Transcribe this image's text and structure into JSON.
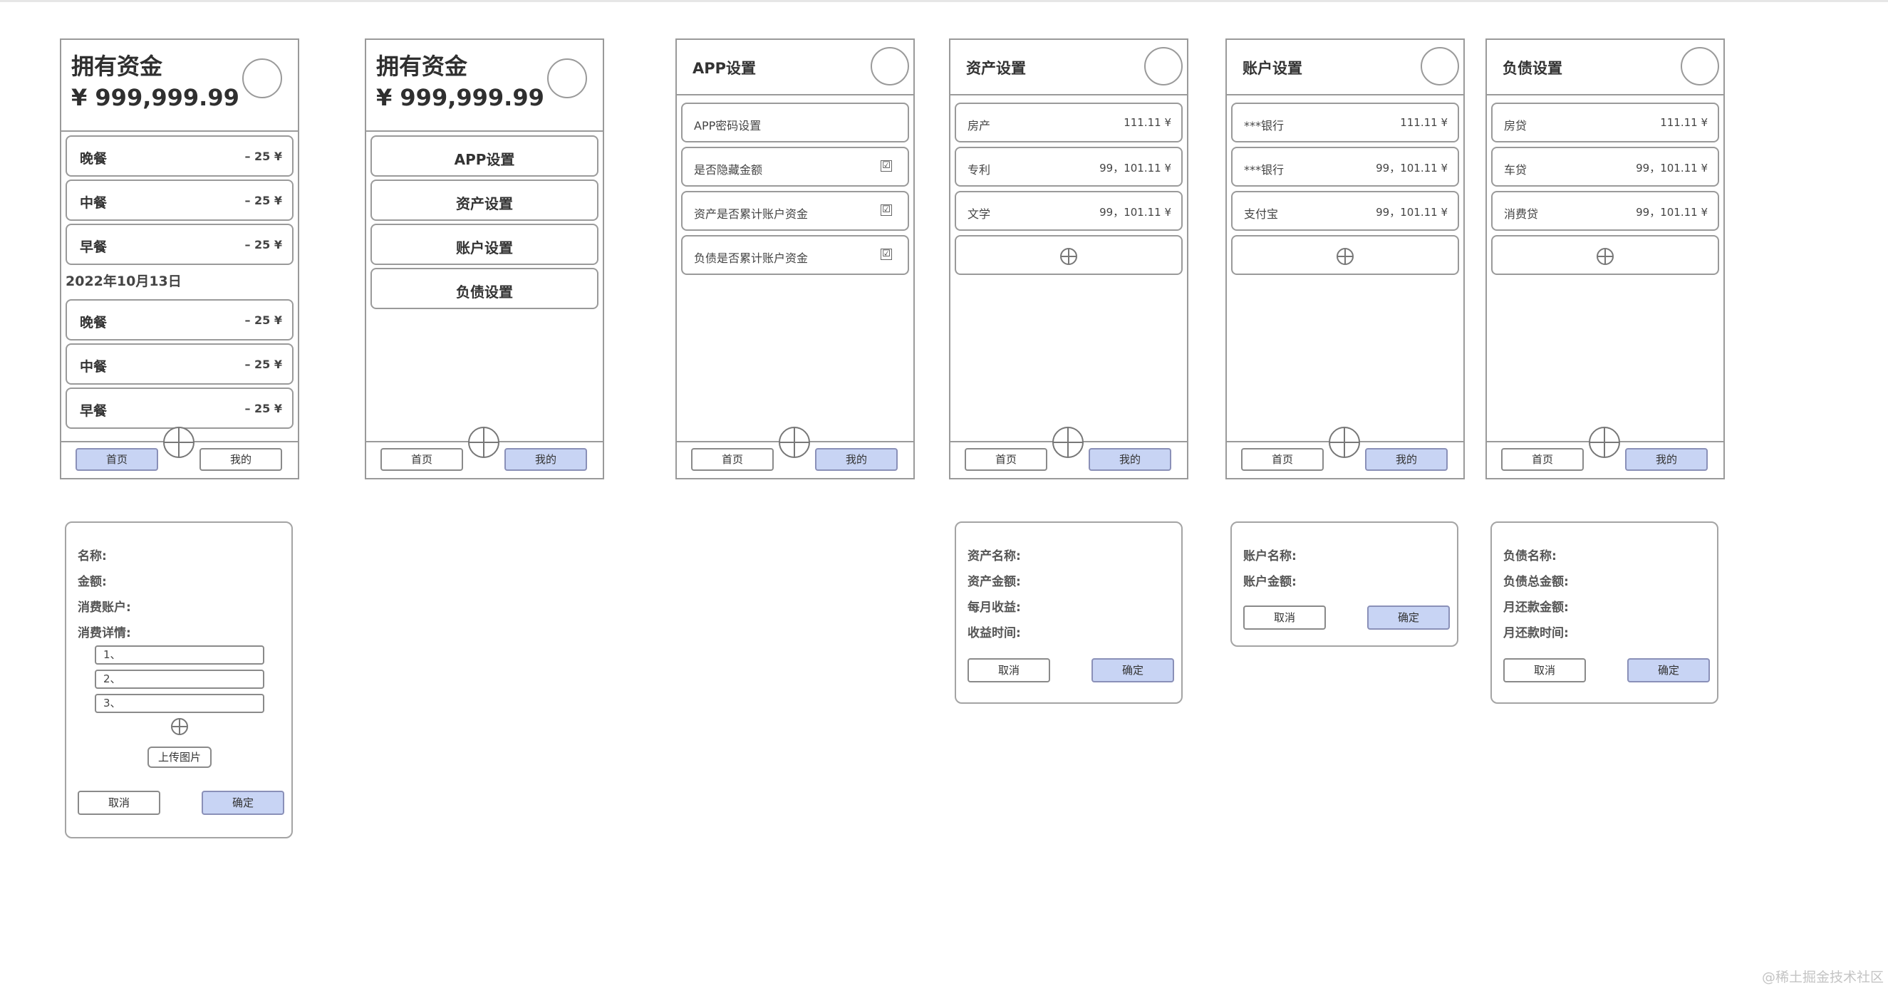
{
  "home": {
    "title": "拥有资金",
    "amount": "¥ 999,999.99",
    "items_today": [
      {
        "label": "晚餐",
        "value": "– 25 ¥"
      },
      {
        "label": "中餐",
        "value": "– 25 ¥"
      },
      {
        "label": "早餐",
        "value": "– 25 ¥"
      }
    ],
    "date_label": "2022年10月13日",
    "items_prev": [
      {
        "label": "晚餐",
        "value": "– 25 ¥"
      },
      {
        "label": "中餐",
        "value": "– 25 ¥"
      },
      {
        "label": "早餐",
        "value": "– 25 ¥"
      }
    ]
  },
  "mine": {
    "title": "拥有资金",
    "amount": "¥ 999,999.99",
    "menu": [
      "APP设置",
      "资产设置",
      "账户设置",
      "负债设置"
    ]
  },
  "app_settings": {
    "title": "APP设置",
    "items": [
      {
        "label": "APP密码设置",
        "checked": false
      },
      {
        "label": "是否隐藏金额",
        "checked": true
      },
      {
        "label": "资产是否累计账户资金",
        "checked": true
      },
      {
        "label": "负债是否累计账户资金",
        "checked": true
      }
    ],
    "check_mark": "☑"
  },
  "asset_settings": {
    "title": "资产设置",
    "items": [
      {
        "label": "房产",
        "value": "111.11 ¥"
      },
      {
        "label": "专利",
        "value": "99，101.11 ¥"
      },
      {
        "label": "文学",
        "value": "99，101.11 ¥"
      }
    ]
  },
  "account_settings": {
    "title": "账户设置",
    "items": [
      {
        "label": "***银行",
        "value": "111.11 ¥"
      },
      {
        "label": "***银行",
        "value": "99，101.11 ¥"
      },
      {
        "label": "支付宝",
        "value": "99，101.11 ¥"
      }
    ]
  },
  "debt_settings": {
    "title": "负债设置",
    "items": [
      {
        "label": "房贷",
        "value": "111.11 ¥"
      },
      {
        "label": "车贷",
        "value": "99，101.11 ¥"
      },
      {
        "label": "消费贷",
        "value": "99，101.11 ¥"
      }
    ]
  },
  "nav": {
    "home": "首页",
    "mine": "我的"
  },
  "expense_dialog": {
    "fields": [
      "名称:",
      "金额:",
      "消费账户:",
      "消费详情:"
    ],
    "details": [
      "1、",
      "2、",
      "3、"
    ],
    "upload": "上传图片",
    "cancel": "取消",
    "ok": "确定"
  },
  "asset_dialog": {
    "fields": [
      "资产名称:",
      "资产金额:",
      "每月收益:",
      "收益时间:"
    ],
    "cancel": "取消",
    "ok": "确定"
  },
  "account_dialog": {
    "fields": [
      "账户名称:",
      "账户金额:"
    ],
    "cancel": "取消",
    "ok": "确定"
  },
  "debt_dialog": {
    "fields": [
      "负债名称:",
      "负债总金额:",
      "月还款金额:",
      "月还款时间:"
    ],
    "cancel": "取消",
    "ok": "确定"
  },
  "watermark": "@稀土掘金技术社区",
  "colors": {
    "border": "#9a9a9a",
    "active_button": "#c8d4f4",
    "text": "#333333"
  }
}
